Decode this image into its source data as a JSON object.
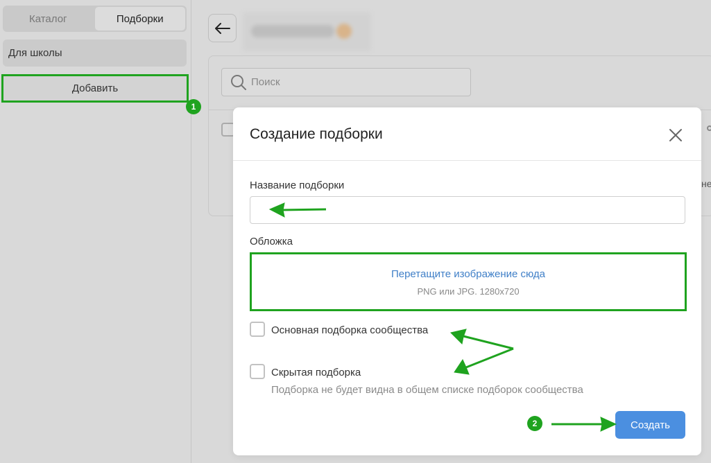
{
  "sidebar": {
    "tabs": [
      {
        "label": "Каталог",
        "active": false
      },
      {
        "label": "Подборки",
        "active": true
      }
    ],
    "items": [
      {
        "label": "Для школы"
      }
    ],
    "add_label": "Добавить"
  },
  "main": {
    "search": {
      "placeholder": "Поиск"
    },
    "partial_text": "не"
  },
  "modal": {
    "title": "Создание подборки",
    "name_label": "Название подборки",
    "name_value": "",
    "cover_label": "Обложка",
    "dropzone": {
      "main": "Перетащите изображение сюда",
      "sub": "PNG или JPG. 1280x720"
    },
    "checkbox_main": {
      "label": "Основная подборка сообщества",
      "checked": false
    },
    "checkbox_hidden": {
      "label": "Скрытая подборка",
      "hint": "Подборка не будет видна в общем списке подборок сообщества",
      "checked": false
    },
    "create_label": "Создать"
  },
  "annotations": {
    "badge_1": "1",
    "badge_2": "2",
    "accent_color": "#1fa31f"
  },
  "colors": {
    "primary_button": "#4b8fe0",
    "link": "#3f7fc7",
    "overlay_bg": "#d9d9d9"
  }
}
